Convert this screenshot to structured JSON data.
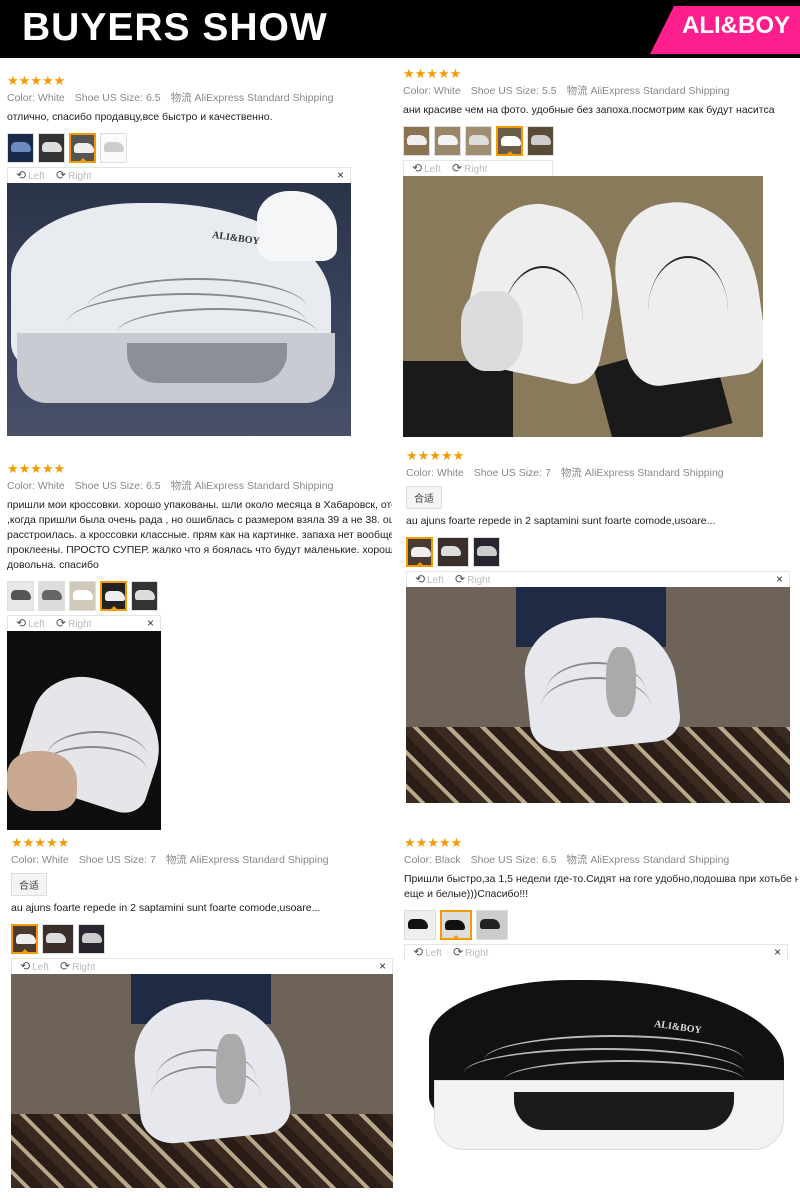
{
  "header": {
    "title": "BUYERS SHOW",
    "brand": "ALI&BOY"
  },
  "colors": {
    "header_bg": "#000000",
    "brand_badge": "#ff1e8e",
    "stars": "#f59a00",
    "active_thumb_border": "#f59a00"
  },
  "viewer_labels": {
    "left": "Left",
    "right": "Right",
    "close": "×"
  },
  "reviews": [
    {
      "stars": "★★★★★",
      "color": "Color: White",
      "size": "Shoe US Size: 6.5",
      "shipping": "物流 AliExpress Standard Shipping",
      "tag": "",
      "text": [
        "отлично, спасибо продавцу,все быстро и качественно."
      ],
      "thumb_count": 4,
      "active_thumb": 2,
      "shoe_logo": "ALI&BOY"
    },
    {
      "stars": "★★★★★",
      "color": "Color: White",
      "size": "Shoe US Size: 5.5",
      "shipping": "物流 AliExpress Standard Shipping",
      "tag": "",
      "text": [
        "ани красиве чем на фото. удобные без запоха.посмотрим как будут наситса"
      ],
      "thumb_count": 5,
      "active_thumb": 3,
      "shoe_logo": ""
    },
    {
      "stars": "★★★★★",
      "color": "Color: White",
      "size": "Shoe US Size: 6.5",
      "shipping": "物流 AliExpress Standard Shipping",
      "tag": "",
      "text": [
        "пришли мои кроссовки. хорошо упакованы. шли около месяца в Хабаровск, отслежив",
        ",когда пришли была очень рада , но ошиблась с размером взяла 39 а не 38. ошиблас",
        "расстроилась. а кроссовки классные. прям как на картинке. запаха нет вообще. в отл",
        "проклеены. ПРОСТО СУПЕР. жалко что я боялась что будут маленькие. хорошо моетс",
        "довольна. спасибо"
      ],
      "thumb_count": 5,
      "active_thumb": 3,
      "shoe_logo": ""
    },
    {
      "stars": "★★★★★",
      "color": "Color: White",
      "size": "Shoe US Size: 7",
      "shipping": "物流 AliExpress Standard Shipping",
      "tag": "合适",
      "text": [
        "au ajuns foarte repede in 2 saptamini sunt foarte comode,usoare..."
      ],
      "thumb_count": 3,
      "active_thumb": 0,
      "shoe_logo": ""
    },
    {
      "stars": "★★★★★",
      "color": "Color: White",
      "size": "Shoe US Size: 7",
      "shipping": "物流 AliExpress Standard Shipping",
      "tag": "合适",
      "text": [
        "au ajuns foarte repede in 2 saptamini sunt foarte comode,usoare..."
      ],
      "thumb_count": 3,
      "active_thumb": 0,
      "shoe_logo": ""
    },
    {
      "stars": "★★★★★",
      "color": "Color: Black",
      "size": "Shoe US Size: 6.5",
      "shipping": "物流 AliExpress Standard Shipping",
      "tag": "",
      "text": [
        "Пришли быстро,за 1,5 недели где-то.Сидят на гоге удобно,подошва при хотьбе н",
        "еще и белые)))Спасибо!!!"
      ],
      "thumb_count": 3,
      "active_thumb": 1,
      "shoe_logo": "ALI&BOY"
    }
  ]
}
